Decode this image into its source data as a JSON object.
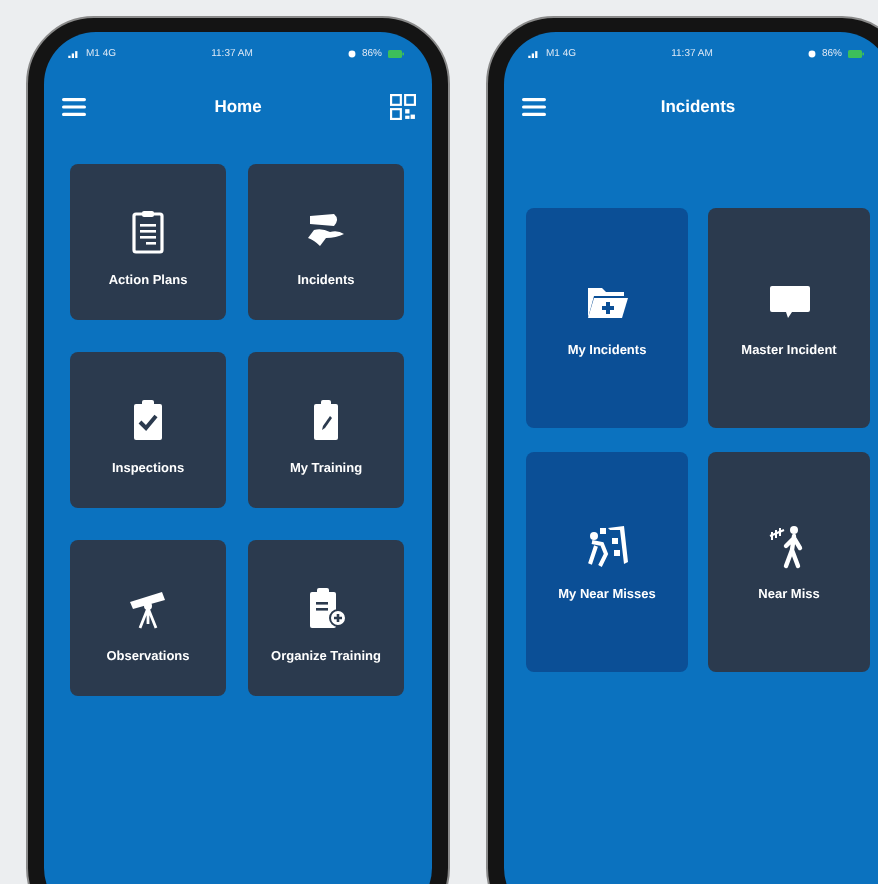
{
  "phones": [
    {
      "status_bar": {
        "carrier": "M1 4G",
        "time": "11:37 AM",
        "battery": "86%"
      },
      "title": "Home",
      "tiles": [
        {
          "label": "Action Plans",
          "color": "#2b3a4e"
        },
        {
          "label": "Incidents",
          "color": "#2b3a4e"
        },
        {
          "label": "Inspections",
          "color": "#2b3a4e"
        },
        {
          "label": "My Training",
          "color": "#2b3a4e"
        },
        {
          "label": "Observations",
          "color": "#2b3a4e"
        },
        {
          "label": "Organize Training",
          "color": "#2b3a4e"
        }
      ]
    },
    {
      "status_bar": {
        "carrier": "M1 4G",
        "time": "11:37 AM",
        "battery": "86%"
      },
      "title": "Incidents",
      "tiles": [
        {
          "label": "My Incidents",
          "color": "#0b4f96"
        },
        {
          "label": "Master Incident",
          "color": "#2b3a4e"
        },
        {
          "label": "My Near Misses",
          "color": "#0b4f96"
        },
        {
          "label": "Near Miss",
          "color": "#2b3a4e"
        }
      ]
    }
  ]
}
